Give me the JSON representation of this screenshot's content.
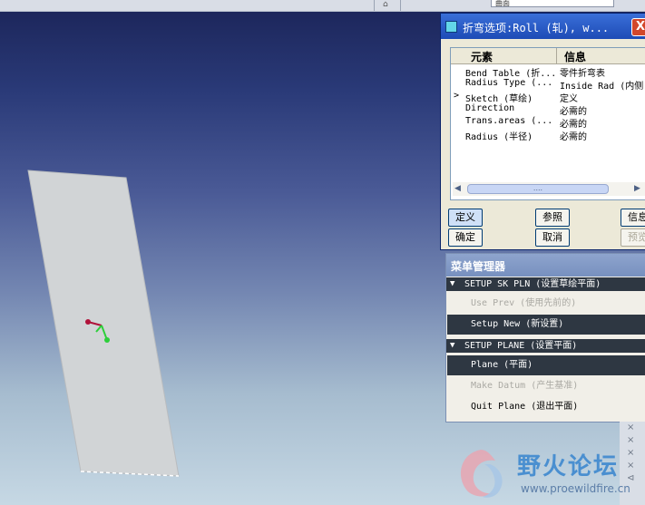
{
  "top_strip": {
    "combo_value": "曲面"
  },
  "viewport": {
    "plate_color": "#d1d4d6",
    "csys_colors": {
      "origin": "#b0123a",
      "x": "#b0123a",
      "y": "#2ccf3a"
    }
  },
  "dialog": {
    "title": "折弯选项:Roll (轧), w...",
    "close_glyph": "X",
    "columns": {
      "element": "元素",
      "info": "信息"
    },
    "rows": [
      {
        "element": "Bend Table (折...",
        "info": "零件折弯表",
        "current": false
      },
      {
        "element": "Radius Type (...",
        "info": "Inside Rad (内侧",
        "current": false
      },
      {
        "element": "Sketch (草绘)",
        "info": "定义",
        "current": true
      },
      {
        "element": "Direction",
        "info": "必需的",
        "current": false
      },
      {
        "element": "Trans.areas (...",
        "info": "必需的",
        "current": false
      },
      {
        "element": "Radius (半径)",
        "info": "必需的",
        "current": false
      }
    ],
    "scroll_left": "◀",
    "scroll_thumb": "....",
    "scroll_right": "▶",
    "buttons": {
      "define": "定义",
      "refs": "参照",
      "info": "信息",
      "ok": "确定",
      "cancel": "取消",
      "preview": "预览"
    }
  },
  "menu_manager": {
    "title": "菜单管理器",
    "section1": "SETUP SK PLN (设置草绘平面)",
    "item_use_prev": "Use Prev (使用先前的)",
    "item_setup_new": "Setup New (新设置)",
    "section2": "SETUP PLANE (设置平面)",
    "item_plane": "Plane (平面)",
    "item_make_datum": "Make Datum (产生基准)",
    "item_quit_plane": "Quit Plane (退出平面)"
  },
  "edge_tools": [
    "×",
    "×",
    "×",
    "×",
    "⊲"
  ],
  "watermark": {
    "brand": "野火论坛",
    "url": "www.proewildfire.cn"
  }
}
